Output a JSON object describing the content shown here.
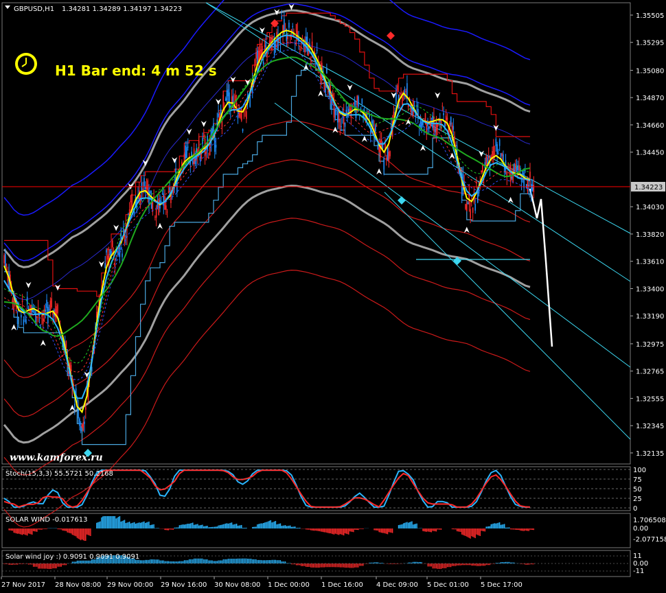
{
  "header": {
    "symbol_label": "GBPUSD,H1",
    "ohlc": "1.34281 1.34289 1.34197 1.34223"
  },
  "timer": {
    "text": "H1 Bar end: 4 m 52 s",
    "icon": "clock-icon"
  },
  "watermark": "www.kamforex.ru",
  "current_price": "1.34223",
  "colors": {
    "background": "#000000",
    "grid": "#404040",
    "bull_candle": "#1e90ff",
    "bear_candle": "#ff2a2a",
    "upper_band": "#1a1aff",
    "lower_band": "#cc1a1a",
    "envelope_gray": "#a0a0a0",
    "trend_lines": "#3cd7f0",
    "price_line": "#ff0000",
    "ma_yellow": "#ffff00",
    "ma_green": "#1faa1f"
  },
  "subwindows": {
    "stoch": {
      "label": "Stoch(15,3,3) 55.5721 50.2168",
      "levels": [
        "100",
        "75",
        "50",
        "25",
        "0"
      ]
    },
    "solar_wind": {
      "label": "SOLAR WIND -0.017613",
      "levels": [
        "1.706508",
        "0.00",
        "-2.077158"
      ]
    },
    "solar_joy": {
      "label": "Solar wind joy :) 0.9091 0.9091 0.9091",
      "levels": [
        "11",
        "0.00",
        "-11"
      ]
    }
  },
  "chart_data": {
    "type": "candlestick",
    "symbol": "GBPUSD",
    "timeframe": "H1",
    "price_axis": {
      "ticks": [
        "1.35505",
        "1.35295",
        "1.35080",
        "1.34870",
        "1.34660",
        "1.34450",
        "1.34030",
        "1.33820",
        "1.33610",
        "1.33400",
        "1.33190",
        "1.32975",
        "1.32765",
        "1.32555",
        "1.32345",
        "1.32135"
      ],
      "range": [
        1.3205,
        1.356
      ]
    },
    "time_axis": {
      "ticks": [
        "27 Nov 2017",
        "28 Nov 08:00",
        "29 Nov 00:00",
        "29 Nov 16:00",
        "30 Nov 08:00",
        "1 Dec 00:00",
        "1 Dec 16:00",
        "4 Dec 09:00",
        "5 Dec 01:00",
        "5 Dec 17:00"
      ]
    },
    "path": [
      1.3365,
      1.335,
      1.333,
      1.3322,
      1.3318,
      1.3324,
      1.3328,
      1.3322,
      1.3318,
      1.332,
      1.3326,
      1.3322,
      1.3305,
      1.3285,
      1.3268,
      1.3248,
      1.3232,
      1.3255,
      1.3285,
      1.3315,
      1.334,
      1.3358,
      1.337,
      1.3368,
      1.3372,
      1.3385,
      1.34,
      1.341,
      1.3415,
      1.3418,
      1.3413,
      1.3403,
      1.3408,
      1.3403,
      1.341,
      1.342,
      1.343,
      1.344,
      1.3442,
      1.344,
      1.3445,
      1.3448,
      1.345,
      1.3455,
      1.3465,
      1.348,
      1.3488,
      1.3482,
      1.3478,
      1.347,
      1.348,
      1.35,
      1.3516,
      1.352,
      1.3525,
      1.353,
      1.3534,
      1.3538,
      1.354,
      1.3538,
      1.3535,
      1.3532,
      1.353,
      1.3525,
      1.352,
      1.351,
      1.35,
      1.349,
      1.3482,
      1.3474,
      1.347,
      1.3476,
      1.348,
      1.3478,
      1.3475,
      1.347,
      1.3462,
      1.345,
      1.344,
      1.3445,
      1.347,
      1.349,
      1.3493,
      1.3488,
      1.3478,
      1.3472,
      1.3468,
      1.3468,
      1.3468,
      1.347,
      1.3472,
      1.3468,
      1.3462,
      1.3445,
      1.342,
      1.3405,
      1.3404,
      1.3412,
      1.3425,
      1.3435,
      1.344,
      1.3445,
      1.3442,
      1.3432,
      1.3428,
      1.343,
      1.3428,
      1.3425,
      1.3422
    ]
  }
}
